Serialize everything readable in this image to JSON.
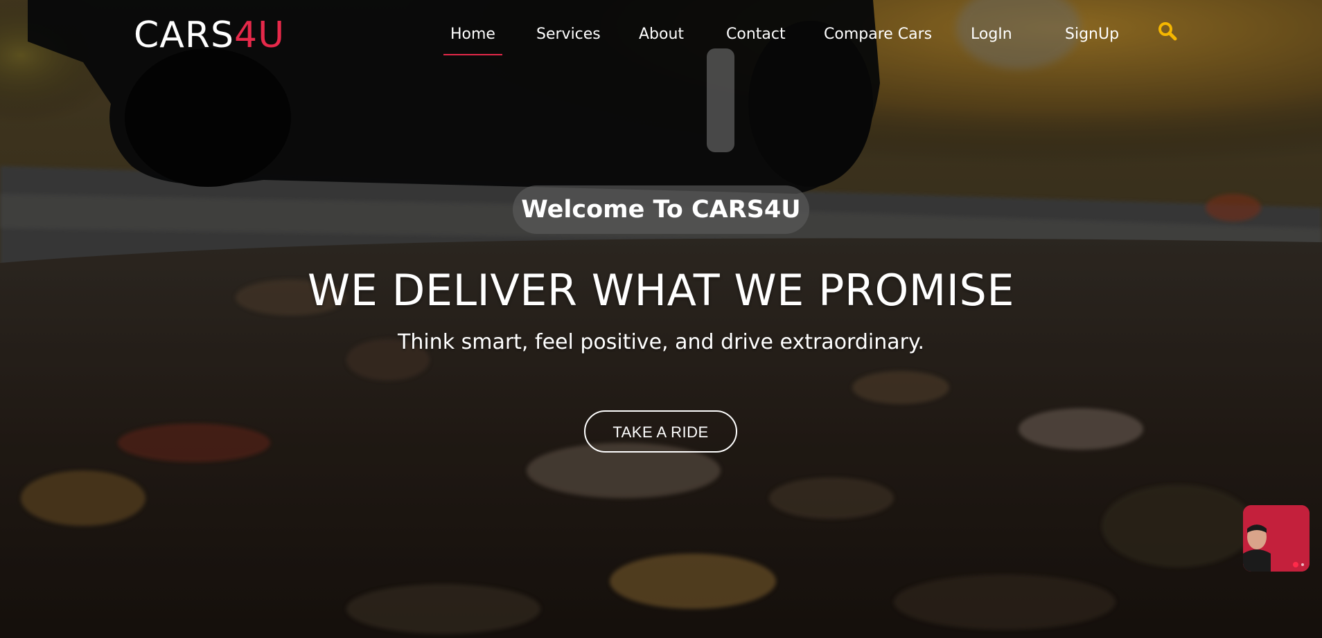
{
  "brand": {
    "logo_primary": "CARS",
    "logo_accent": "4U",
    "accent_color": "#e6294a"
  },
  "nav": {
    "items": [
      {
        "label": "Home",
        "active": true
      },
      {
        "label": "Services",
        "active": false
      },
      {
        "label": "About",
        "active": false
      },
      {
        "label": "Contact",
        "active": false
      },
      {
        "label": "Compare Cars",
        "active": false
      },
      {
        "label": "LogIn",
        "active": false
      },
      {
        "label": "SignUp",
        "active": false
      }
    ],
    "search_icon": "search-icon",
    "search_icon_color": "#f5b700"
  },
  "hero": {
    "welcome": "Welcome To CARS4U",
    "headline": "WE DELIVER WHAT WE PROMISE",
    "subline": "Think smart, feel positive, and drive extraordinary.",
    "cta_label": "TAKE A RIDE"
  },
  "widget": {
    "icon": "video-avatar-icon",
    "color": "#c4203c"
  }
}
